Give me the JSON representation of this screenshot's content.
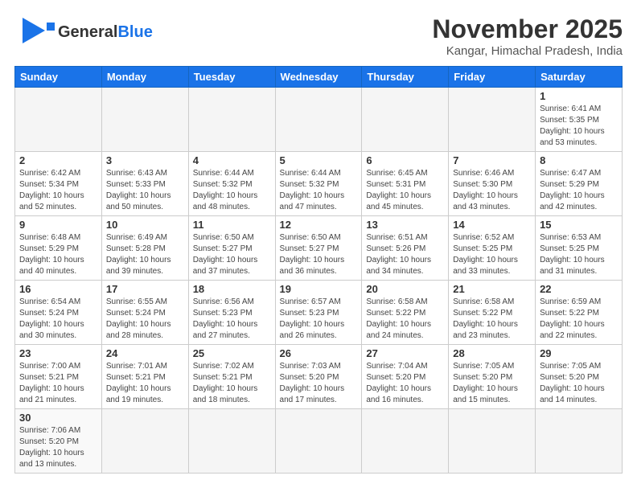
{
  "header": {
    "logo_general": "General",
    "logo_blue": "Blue",
    "title": "November 2025",
    "subtitle": "Kangar, Himachal Pradesh, India"
  },
  "weekdays": [
    "Sunday",
    "Monday",
    "Tuesday",
    "Wednesday",
    "Thursday",
    "Friday",
    "Saturday"
  ],
  "weeks": [
    [
      {
        "day": "",
        "info": ""
      },
      {
        "day": "",
        "info": ""
      },
      {
        "day": "",
        "info": ""
      },
      {
        "day": "",
        "info": ""
      },
      {
        "day": "",
        "info": ""
      },
      {
        "day": "",
        "info": ""
      },
      {
        "day": "1",
        "info": "Sunrise: 6:41 AM\nSunset: 5:35 PM\nDaylight: 10 hours and 53 minutes."
      }
    ],
    [
      {
        "day": "2",
        "info": "Sunrise: 6:42 AM\nSunset: 5:34 PM\nDaylight: 10 hours and 52 minutes."
      },
      {
        "day": "3",
        "info": "Sunrise: 6:43 AM\nSunset: 5:33 PM\nDaylight: 10 hours and 50 minutes."
      },
      {
        "day": "4",
        "info": "Sunrise: 6:44 AM\nSunset: 5:32 PM\nDaylight: 10 hours and 48 minutes."
      },
      {
        "day": "5",
        "info": "Sunrise: 6:44 AM\nSunset: 5:32 PM\nDaylight: 10 hours and 47 minutes."
      },
      {
        "day": "6",
        "info": "Sunrise: 6:45 AM\nSunset: 5:31 PM\nDaylight: 10 hours and 45 minutes."
      },
      {
        "day": "7",
        "info": "Sunrise: 6:46 AM\nSunset: 5:30 PM\nDaylight: 10 hours and 43 minutes."
      },
      {
        "day": "8",
        "info": "Sunrise: 6:47 AM\nSunset: 5:29 PM\nDaylight: 10 hours and 42 minutes."
      }
    ],
    [
      {
        "day": "9",
        "info": "Sunrise: 6:48 AM\nSunset: 5:29 PM\nDaylight: 10 hours and 40 minutes."
      },
      {
        "day": "10",
        "info": "Sunrise: 6:49 AM\nSunset: 5:28 PM\nDaylight: 10 hours and 39 minutes."
      },
      {
        "day": "11",
        "info": "Sunrise: 6:50 AM\nSunset: 5:27 PM\nDaylight: 10 hours and 37 minutes."
      },
      {
        "day": "12",
        "info": "Sunrise: 6:50 AM\nSunset: 5:27 PM\nDaylight: 10 hours and 36 minutes."
      },
      {
        "day": "13",
        "info": "Sunrise: 6:51 AM\nSunset: 5:26 PM\nDaylight: 10 hours and 34 minutes."
      },
      {
        "day": "14",
        "info": "Sunrise: 6:52 AM\nSunset: 5:25 PM\nDaylight: 10 hours and 33 minutes."
      },
      {
        "day": "15",
        "info": "Sunrise: 6:53 AM\nSunset: 5:25 PM\nDaylight: 10 hours and 31 minutes."
      }
    ],
    [
      {
        "day": "16",
        "info": "Sunrise: 6:54 AM\nSunset: 5:24 PM\nDaylight: 10 hours and 30 minutes."
      },
      {
        "day": "17",
        "info": "Sunrise: 6:55 AM\nSunset: 5:24 PM\nDaylight: 10 hours and 28 minutes."
      },
      {
        "day": "18",
        "info": "Sunrise: 6:56 AM\nSunset: 5:23 PM\nDaylight: 10 hours and 27 minutes."
      },
      {
        "day": "19",
        "info": "Sunrise: 6:57 AM\nSunset: 5:23 PM\nDaylight: 10 hours and 26 minutes."
      },
      {
        "day": "20",
        "info": "Sunrise: 6:58 AM\nSunset: 5:22 PM\nDaylight: 10 hours and 24 minutes."
      },
      {
        "day": "21",
        "info": "Sunrise: 6:58 AM\nSunset: 5:22 PM\nDaylight: 10 hours and 23 minutes."
      },
      {
        "day": "22",
        "info": "Sunrise: 6:59 AM\nSunset: 5:22 PM\nDaylight: 10 hours and 22 minutes."
      }
    ],
    [
      {
        "day": "23",
        "info": "Sunrise: 7:00 AM\nSunset: 5:21 PM\nDaylight: 10 hours and 21 minutes."
      },
      {
        "day": "24",
        "info": "Sunrise: 7:01 AM\nSunset: 5:21 PM\nDaylight: 10 hours and 19 minutes."
      },
      {
        "day": "25",
        "info": "Sunrise: 7:02 AM\nSunset: 5:21 PM\nDaylight: 10 hours and 18 minutes."
      },
      {
        "day": "26",
        "info": "Sunrise: 7:03 AM\nSunset: 5:20 PM\nDaylight: 10 hours and 17 minutes."
      },
      {
        "day": "27",
        "info": "Sunrise: 7:04 AM\nSunset: 5:20 PM\nDaylight: 10 hours and 16 minutes."
      },
      {
        "day": "28",
        "info": "Sunrise: 7:05 AM\nSunset: 5:20 PM\nDaylight: 10 hours and 15 minutes."
      },
      {
        "day": "29",
        "info": "Sunrise: 7:05 AM\nSunset: 5:20 PM\nDaylight: 10 hours and 14 minutes."
      }
    ],
    [
      {
        "day": "30",
        "info": "Sunrise: 7:06 AM\nSunset: 5:20 PM\nDaylight: 10 hours and 13 minutes."
      },
      {
        "day": "",
        "info": ""
      },
      {
        "day": "",
        "info": ""
      },
      {
        "day": "",
        "info": ""
      },
      {
        "day": "",
        "info": ""
      },
      {
        "day": "",
        "info": ""
      },
      {
        "day": "",
        "info": ""
      }
    ]
  ]
}
